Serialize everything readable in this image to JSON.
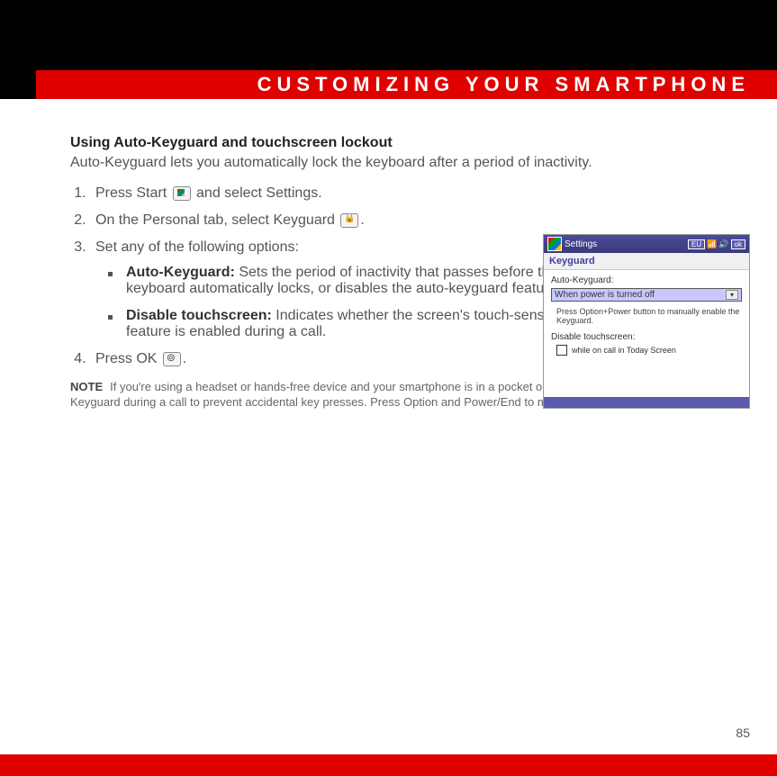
{
  "header": {
    "chapter_title": "CUSTOMIZING YOUR SMARTPHONE"
  },
  "section": {
    "title": "Using Auto-Keyguard and touchscreen lockout",
    "intro": "Auto-Keyguard lets you automatically lock the keyboard after a period of inactivity."
  },
  "steps": {
    "s1a": "Press Start ",
    "s1b": " and select Settings.",
    "s2a": "On the Personal tab, select Keyguard ",
    "s2b": ".",
    "s3": "Set any of the following options:",
    "s4a": "Press OK ",
    "s4b": "."
  },
  "options": {
    "opt1_label": "Auto-Keyguard:",
    "opt1_text": " Sets the period of inactivity that passes before the keyboard automatically locks, or disables the auto-keyguard feature.",
    "opt2_label": "Disable touchscreen:",
    "opt2_text": " Indicates whether the screen's touch-sensitive feature is enabled during a call."
  },
  "note": {
    "label": "NOTE",
    "text": "If you're using a headset or hands-free device and your smartphone is in a pocket or bag, you can manually turn on Keyguard during a call to prevent accidental key presses. Press Option and Power/End to manually turn on Keyguard."
  },
  "screenshot": {
    "titlebar_label": "Settings",
    "status_badge": "EU",
    "ok_button": "ok",
    "app_title": "Keyguard",
    "field1_label": "Auto-Keyguard:",
    "dropdown_value": "When power is turned off",
    "hint": "Press Option+Power button to manually enable the Keyguard.",
    "field2_label": "Disable touchscreen:",
    "checkbox_label": "while on call in Today Screen"
  },
  "page_number": "85"
}
